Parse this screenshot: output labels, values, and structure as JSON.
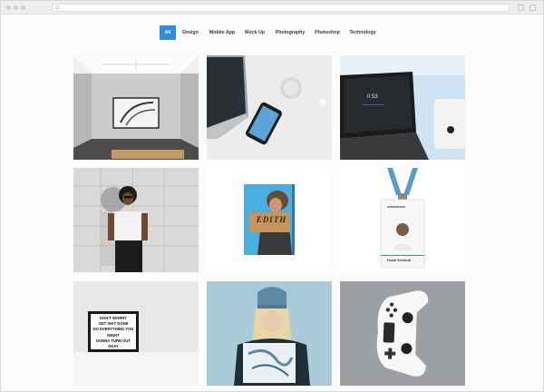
{
  "filters": [
    {
      "label": "All",
      "active": true
    },
    {
      "label": "Design"
    },
    {
      "label": "Mobile App"
    },
    {
      "label": "Mock Up"
    },
    {
      "label": "Photography"
    },
    {
      "label": "Photoshop"
    },
    {
      "label": "Technology"
    }
  ],
  "tiles": {
    "laptop_clock": "0:53",
    "book_title": "EDITH",
    "badge_name": "Hoodi Schinedi",
    "poster_lines": [
      "DON'T WORRY",
      "GET SH!T DONE",
      "DO EVERYTHING YOU",
      "MIGHT",
      "DONNA TURN OUT OKAY"
    ]
  },
  "colors": {
    "accent": "#2b8ee0",
    "page_bg": "#fcfcfc"
  }
}
